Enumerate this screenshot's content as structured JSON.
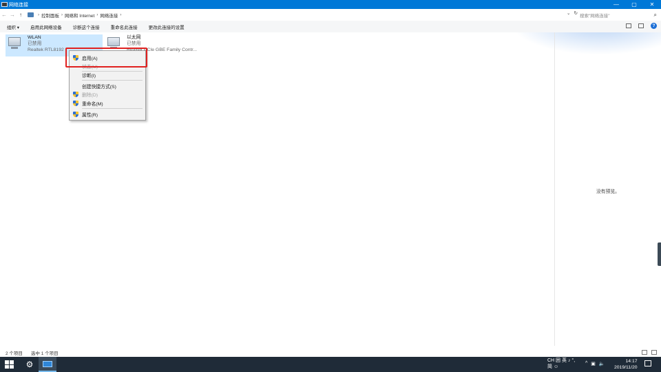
{
  "window": {
    "title": "网络连接",
    "controls": {
      "minimize": "—",
      "maximize": "▢",
      "close": "✕"
    }
  },
  "addressbar": {
    "back": "←",
    "forward": "→",
    "up": "↑",
    "crumbs": [
      "控制面板",
      "网络和 Internet",
      "网络连接"
    ],
    "refresh": "↻",
    "search_placeholder": "搜索\"网络连接\""
  },
  "commandbar": {
    "items": [
      "组织 ▾",
      "启用此网络设备",
      "诊断这个连接",
      "重命名此连接",
      "更改此连接的设置"
    ],
    "help": "?"
  },
  "connections": [
    {
      "name": "WLAN",
      "status": "已禁用",
      "device": "Realtek RTL8192"
    },
    {
      "name": "以太网",
      "status": "已禁用",
      "device": "Realtek PCIe GBE Family Contr..."
    }
  ],
  "context_menu": {
    "items": [
      {
        "label": "启用(A)",
        "shield": true,
        "disabled": false
      },
      {
        "label": "状态(U)",
        "shield": false,
        "disabled": true
      },
      {
        "label": "诊断(I)",
        "shield": false,
        "disabled": false
      },
      {
        "label": "创建快捷方式(S)",
        "shield": false,
        "disabled": false
      },
      {
        "label": "删除(D)",
        "shield": true,
        "disabled": true
      },
      {
        "label": "重命名(M)",
        "shield": true,
        "disabled": false
      },
      {
        "label": "属性(R)",
        "shield": true,
        "disabled": false
      }
    ]
  },
  "preview": {
    "text": "没有预览。"
  },
  "statusbar": {
    "count": "2 个项目",
    "selected": "选中 1 个项目"
  },
  "taskbar": {
    "ime_top": "CH 囲 英 ♪ °,",
    "ime_bottom": "简 ☺",
    "time": "14:17",
    "date": "2019/11/20"
  },
  "colors": {
    "titlebar": "#0078d7",
    "selection": "#cce8ff",
    "highlight_border": "#e0201f",
    "taskbar": "#1f2b38"
  }
}
